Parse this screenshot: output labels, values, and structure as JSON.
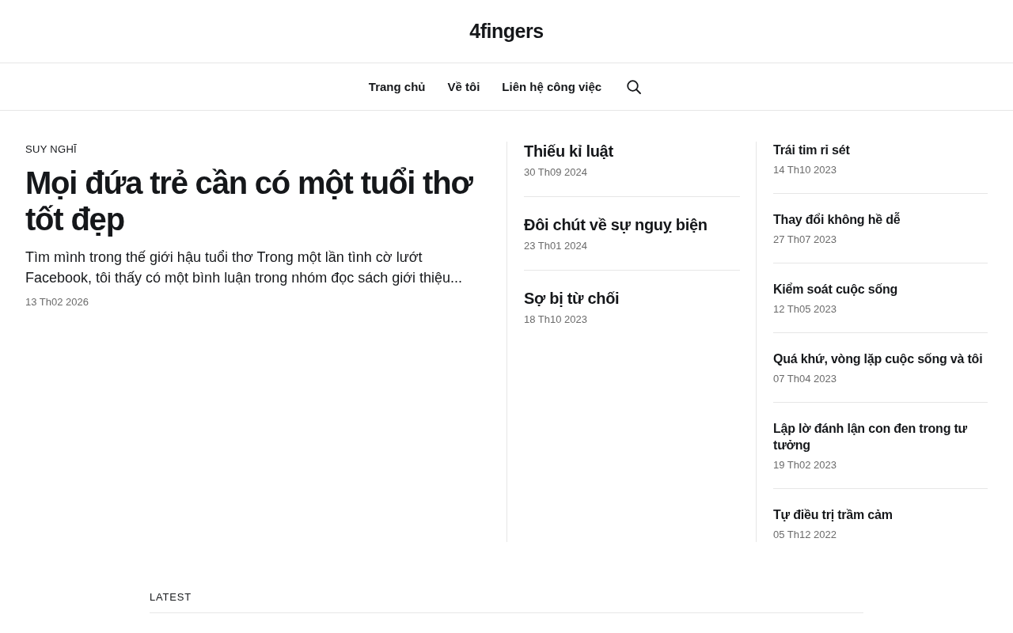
{
  "site": {
    "title": "4fingers"
  },
  "nav": {
    "items": [
      {
        "label": "Trang chủ"
      },
      {
        "label": "Về tôi"
      },
      {
        "label": "Liên hệ công việc"
      }
    ]
  },
  "featured": {
    "category": "SUY NGHĨ",
    "title": "Mọi đứa trẻ cần có một tuổi thơ tốt đẹp",
    "excerpt": "Tìm mình trong thế giới hậu tuổi thơ Trong một lần tình cờ lướt Facebook, tôi thấy có một bình luận trong nhóm đọc sách giới thiệu...",
    "date": "13 Th02 2026"
  },
  "middle_posts": [
    {
      "title": "Thiếu kỉ luật",
      "date": "30 Th09 2024"
    },
    {
      "title": "Đôi chút về sự nguỵ biện",
      "date": "23 Th01 2024"
    },
    {
      "title": "Sợ bị từ chối",
      "date": "18 Th10 2023"
    }
  ],
  "side_posts": [
    {
      "title": "Trái tim rỉ sét",
      "date": "14 Th10 2023"
    },
    {
      "title": "Thay đổi không hề dễ",
      "date": "27 Th07 2023"
    },
    {
      "title": "Kiểm soát cuộc sống",
      "date": "12 Th05 2023"
    },
    {
      "title": "Quá khứ, vòng lặp cuộc sống và tôi",
      "date": "07 Th04 2023"
    },
    {
      "title": "Lập lờ đánh lận con đen trong tư tưởng",
      "date": "19 Th02 2023"
    },
    {
      "title": "Tự điều trị trầm cảm",
      "date": "05 Th12 2022"
    }
  ],
  "latest": {
    "heading": "LATEST"
  }
}
